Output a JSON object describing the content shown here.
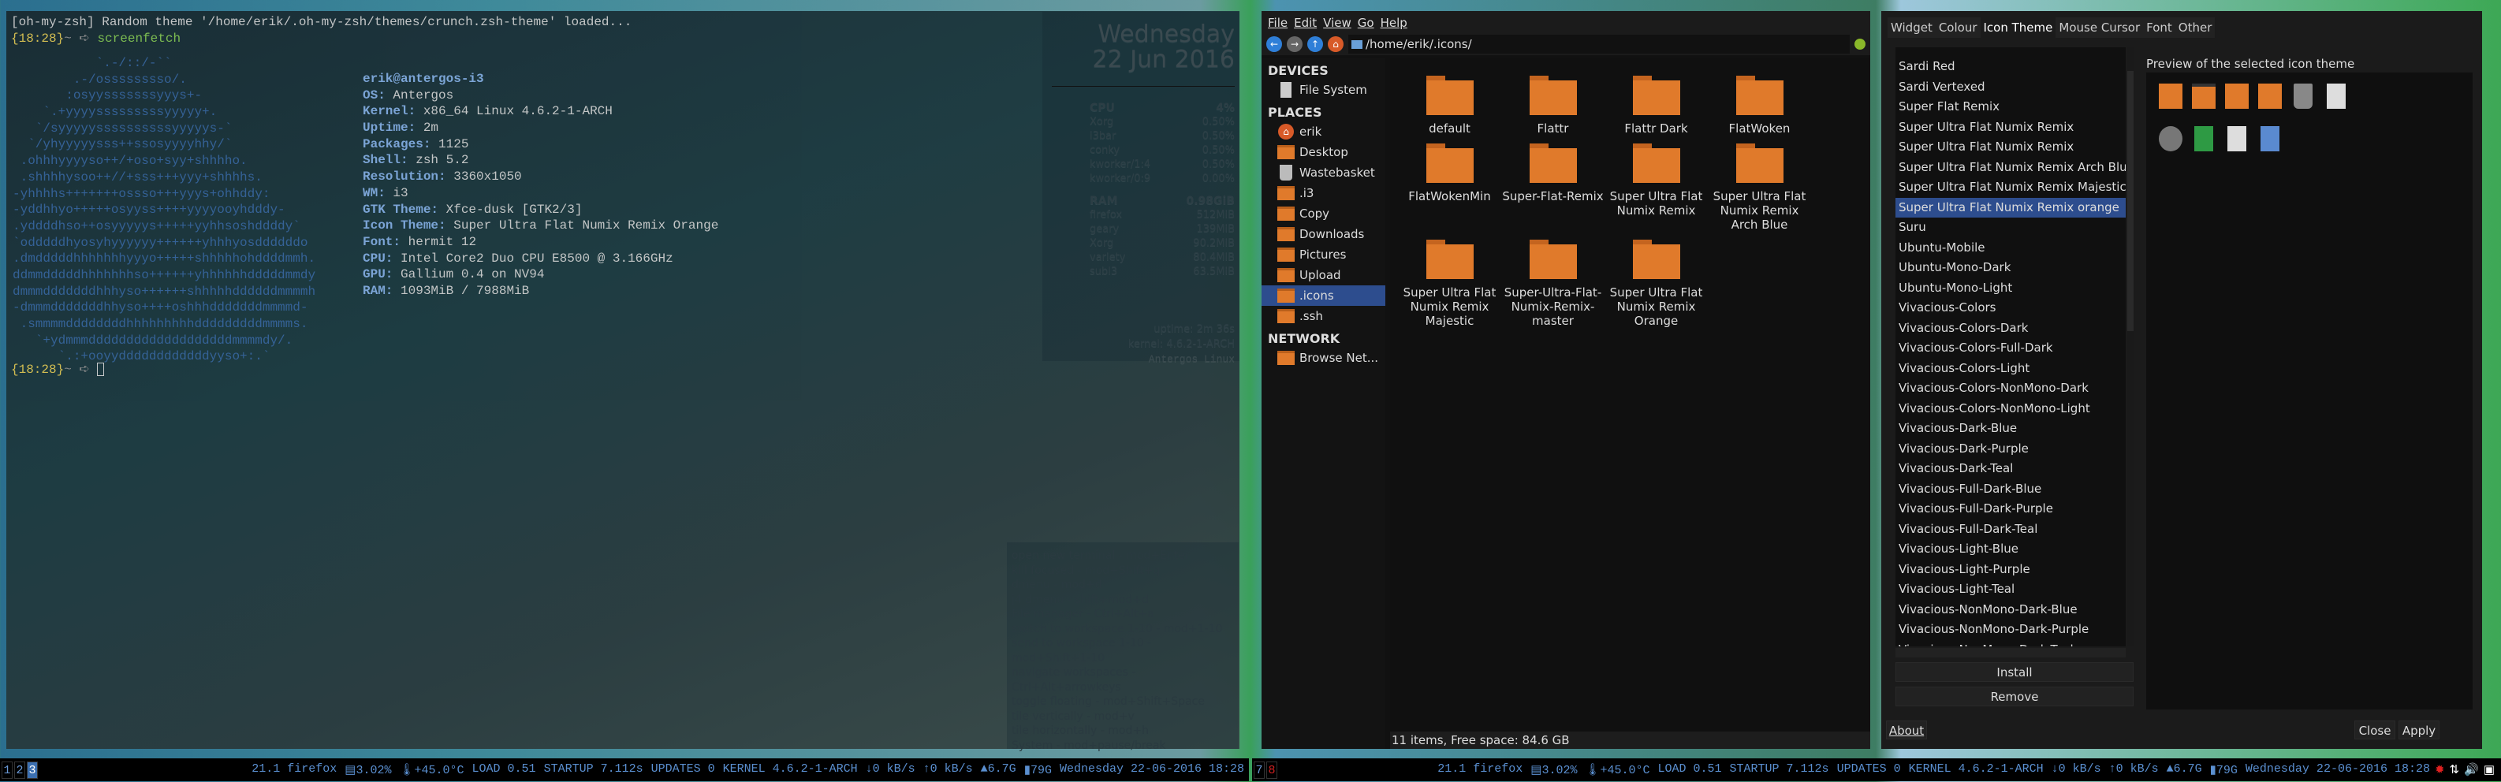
{
  "terminal": {
    "theme_msg": "[oh-my-zsh] Random theme '/home/erik/.oh-my-zsh/themes/crunch.zsh-theme' loaded...",
    "prompt_time": "{18:28}",
    "prompt_sym": "~ ➪ ",
    "command": "screenfetch",
    "art": [
      "           `.-/::/-``",
      "        .-/osssssssso/.",
      "       :osyysssssssyyys+-",
      "    `.+yyyysssssssssyyyyy+.",
      "   `/syyyyyssssssssssyyyyys-`",
      "  `/yhyyyyysss++ssosyyyyhhy/`",
      " .ohhhyyyyso++/+oso+syy+shhhho.",
      " .shhhhysoo++//+sss+++yyy+shhhhs.",
      "-yhhhhs+++++++ossso+++yyys+ohhddy:",
      "-yddhhyo+++++osyyss++++yyyyooyhdddy-",
      ".yddddhso++osyyyyys+++++yyhhsoshddddy`",
      "`odddddhyosyhyyyyyy++++++yhhhyosddddddo",
      ".dmdddddhhhhhhhyyyo+++++shhhhhohddddmmh.",
      "ddmmdddddhhhhhhhso++++++yhhhhhhdddddmmdy",
      "dmmmdddddddhhhyso++++++shhhhhddddddmmmmh",
      "-dmmmdddddddhhyso++++oshhhdddddddmmmmd-",
      " .smmmmddddddddhhhhhhhhhdddddddddmmmms.",
      "   `+ydmmmdddddddddddddddddddmmmmdy/.",
      "      `.:+ooyyddddddddddddyyso+:.`"
    ],
    "user_host": "erik@antergos-i3",
    "info": [
      {
        "label": "OS:",
        "value": "Antergos"
      },
      {
        "label": "Kernel:",
        "value": "x86_64 Linux 4.6.2-1-ARCH"
      },
      {
        "label": "Uptime:",
        "value": "2m"
      },
      {
        "label": "Packages:",
        "value": "1125"
      },
      {
        "label": "Shell:",
        "value": "zsh 5.2"
      },
      {
        "label": "Resolution:",
        "value": "3360x1050"
      },
      {
        "label": "WM:",
        "value": "i3"
      },
      {
        "label": "GTK Theme:",
        "value": "Xfce-dusk [GTK2/3]"
      },
      {
        "label": "Icon Theme:",
        "value": "Super Ultra Flat Numix Remix Orange"
      },
      {
        "label": "Font:",
        "value": "hermit 12"
      },
      {
        "label": "CPU:",
        "value": "Intel Core2 Duo CPU E8500 @ 3.166GHz"
      },
      {
        "label": "GPU:",
        "value": "Gallium 0.4 on NV94"
      },
      {
        "label": "RAM:",
        "value": "1093MiB / 7988MiB"
      }
    ]
  },
  "conky": {
    "day": "Wednesday",
    "date": "22  Jun  2016",
    "cpu_label": "CPU",
    "cpu_total": "4%",
    "cpu": [
      [
        "Xorg",
        "0.50%"
      ],
      [
        "i3bar",
        "0.50%"
      ],
      [
        "conky",
        "0.50%"
      ],
      [
        "kworker/1:4",
        "0.50%"
      ],
      [
        "kworker/0:9",
        "0.00%"
      ]
    ],
    "ram_label": "RAM",
    "ram_total": "0.98GiB",
    "ram": [
      [
        "firefox",
        "512MiB"
      ],
      [
        "geary",
        "139MiB"
      ],
      [
        "Xorg",
        "90.2MiB"
      ],
      [
        "variety",
        "80.4MiB"
      ],
      [
        "subl3",
        "63.5MiB"
      ]
    ],
    "uptime": "uptime: 2m 36s",
    "kernel": "kernel: 4.6.2-1-ARCH",
    "distro": "Antergos Linux"
  },
  "shortcuts": [
    "open new terminal - mod+Enter",
    "kill focused - mod+Shift+q",
    "dmenu - mod+d",
    "j4 dmenu - shift+mod+d",
    "File manager - Ctrl+Alt+a",
    "switch to workspace 1-10 - mod+1-10",
    "send to workspace 1-10 - mod+Shift+1-10",
    "navigate workspaces - Ctrl+Alt+arrowkeys",
    "toggle floating - mod+Shift+Space",
    "tile vertically - mod+v",
    "tile horizontally - mod+h",
    "System - mod+pause/break",
    "",
    "default mod=<Windows>"
  ],
  "file_manager": {
    "menu": [
      "File",
      "Edit",
      "View",
      "Go",
      "Help"
    ],
    "path": "/home/erik/.icons/",
    "sidebar": {
      "devices_label": "DEVICES",
      "devices": [
        "File System"
      ],
      "places_label": "PLACES",
      "places": [
        "erik",
        "Desktop",
        "Wastebasket",
        ".i3",
        "Copy",
        "Downloads",
        "Pictures",
        "Upload",
        ".icons",
        ".ssh"
      ],
      "selected": ".icons",
      "network_label": "NETWORK",
      "network": [
        "Browse Net..."
      ]
    },
    "items": [
      "default",
      "Flattr",
      "Flattr Dark",
      "FlatWoken",
      "FlatWokenMin",
      "Super-Flat-Remix",
      "Super Ultra Flat Numix Remix",
      "Super Ultra Flat Numix Remix Arch Blue",
      "Super Ultra Flat Numix Remix Majestic",
      "Super-Ultra-Flat-Numix-Remix-master",
      "Super Ultra Flat Numix Remix Orange"
    ],
    "status": "11 items, Free space: 84.6 GB",
    "folder_color": "#e07a2b"
  },
  "theme_window": {
    "tabs": [
      "Widget",
      "Colour",
      "Icon Theme",
      "Mouse Cursor",
      "Font",
      "Other"
    ],
    "active_tab": "Icon Theme",
    "themes": [
      "Sardi Red",
      "Sardi Vertexed",
      "Super Flat Remix",
      "Super Ultra Flat Numix Remix",
      "Super Ultra Flat Numix Remix",
      "Super Ultra Flat Numix Remix Arch Blue",
      "Super Ultra Flat Numix Remix Majestic",
      "Super Ultra Flat Numix Remix orange",
      "Suru",
      "Ubuntu-Mobile",
      "Ubuntu-Mono-Dark",
      "Ubuntu-Mono-Light",
      "Vivacious-Colors",
      "Vivacious-Colors-Dark",
      "Vivacious-Colors-Full-Dark",
      "Vivacious-Colors-Light",
      "Vivacious-Colors-NonMono-Dark",
      "Vivacious-Colors-NonMono-Light",
      "Vivacious-Dark-Blue",
      "Vivacious-Dark-Purple",
      "Vivacious-Dark-Teal",
      "Vivacious-Full-Dark-Blue",
      "Vivacious-Full-Dark-Purple",
      "Vivacious-Full-Dark-Teal",
      "Vivacious-Light-Blue",
      "Vivacious-Light-Purple",
      "Vivacious-Light-Teal",
      "Vivacious-NonMono-Dark-Blue",
      "Vivacious-NonMono-Dark-Purple",
      "Vivacious-NonMono-Dark-Teal"
    ],
    "selected_index": 7,
    "preview_label": "Preview of the selected icon theme",
    "preview_icons": [
      "folder-home-icon",
      "folder-desktop-icon",
      "folder-icon",
      "folder-remote-icon",
      "trash-icon",
      "text-document-icon",
      "settings-gear-icon",
      "image-document-icon",
      "plain-document-icon",
      "html-document-icon"
    ],
    "install": "Install",
    "remove": "Remove",
    "about": "About",
    "close": "Close",
    "apply": "Apply",
    "selection_color": "#2d4d8e"
  },
  "bar_left": {
    "workspaces": [
      "1",
      "2",
      "3"
    ],
    "active": "3"
  },
  "bar_right": {
    "workspaces": [
      "7",
      "8"
    ],
    "active": "8"
  },
  "bar_status": [
    "21.1 firefox",
    "▤3.02%",
    "🌡+45.0°C",
    "LOAD 0.51",
    "STARTUP 7.112s",
    "UPDATES 0",
    "KERNEL 4.6.2-1-ARCH",
    "↓0 kB/s",
    "↑0 kB/s",
    "▲6.7G",
    "▮79G",
    "Wednesday 22-06-2016 18:28"
  ]
}
